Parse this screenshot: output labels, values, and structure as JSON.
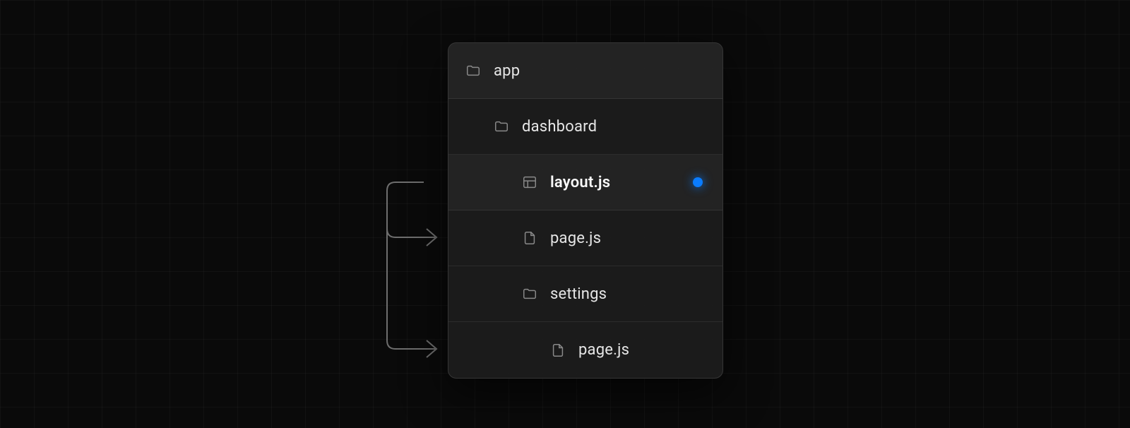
{
  "tree": {
    "rows": [
      {
        "label": "app",
        "icon": "folder",
        "indent": 0,
        "highlight": true,
        "bold": false,
        "dot": false
      },
      {
        "label": "dashboard",
        "icon": "folder",
        "indent": 1,
        "highlight": false,
        "bold": false,
        "dot": false
      },
      {
        "label": "layout.js",
        "icon": "layout",
        "indent": 2,
        "highlight": true,
        "bold": true,
        "dot": true
      },
      {
        "label": "page.js",
        "icon": "file",
        "indent": 2,
        "highlight": false,
        "bold": false,
        "dot": false
      },
      {
        "label": "settings",
        "icon": "folder",
        "indent": 2,
        "highlight": false,
        "bold": false,
        "dot": false
      },
      {
        "label": "page.js",
        "icon": "file",
        "indent": 3,
        "highlight": false,
        "bold": false,
        "dot": false
      }
    ]
  },
  "colors": {
    "dot": "#0a7cff"
  }
}
